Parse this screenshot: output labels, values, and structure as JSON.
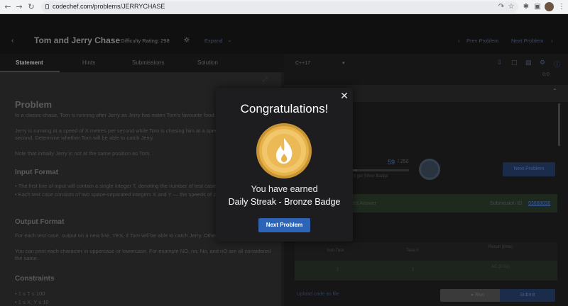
{
  "browser": {
    "url": "codechef.com/problems/JERRYCHASE"
  },
  "header": {
    "title": "Tom and Jerry Chase",
    "difficulty": "Difficulty Rating: 298",
    "expand": "Expand",
    "prev": "Prev Problem",
    "next": "Next Problem"
  },
  "tabs": [
    "Statement",
    "Hints",
    "Submissions",
    "Solution"
  ],
  "editor": {
    "language": "C++17",
    "timer": "0:0"
  },
  "statement": {
    "problem_heading": "Problem",
    "p1": "In a classic chase, Tom is running after Jerry as Jerry has eaten Tom's favourite food.",
    "p2": "Jerry is running at a speed of X metres per second while Tom is chasing him at a speed of Y metres per second. Determine whether Tom will be able to catch Jerry.",
    "p3": "Note that initially Jerry is not at the same position as Tom.",
    "input_heading": "Input Format",
    "input_b1": "The first line of input will contain a single integer T, denoting the number of test cases.",
    "input_b2": "Each test case consists of two space-separated integers X and Y — the speeds of Jerry and Tom respectively.",
    "output_heading": "Output Format",
    "output_p1": "For each test case, output on a new line, YES, if Tom will be able to catch Jerry. Otherwise, output NO.",
    "output_p2": "You can print each character in uppercase or lowercase. For example NO, no, No, and nO are all considered the same.",
    "constraints_heading": "Constraints",
    "constraint_1": "1 ≤ T ≤ 100",
    "constraint_2": "1 ≤ X, Y ≤ 10"
  },
  "right": {
    "progress_value": "59",
    "progress_total": "/ 250",
    "progress_fraction": 0.236,
    "silver_note": "to get Silver Badge",
    "next_problem_button": "Next Problem",
    "answer_label": "Correct Answer",
    "submission_label": "Submission ID:",
    "submission_id": "93688038",
    "table_headers": [
      "Sub-Task",
      "Task #",
      "Result (time)"
    ],
    "table_row": [
      "1",
      "1",
      "AC (0.01)"
    ],
    "upload_label": "Upload code as file",
    "run_button": "Run",
    "submit_button": "Submit"
  },
  "modal": {
    "title": "Congratulations!",
    "earned_text": "You have earned",
    "badge_name": "Daily Streak - Bronze Badge",
    "button": "Next Problem"
  },
  "colors": {
    "modal_bg": "#1d1d1f",
    "button_blue": "#2d64b5",
    "badge_gold": "#e6b24a"
  }
}
